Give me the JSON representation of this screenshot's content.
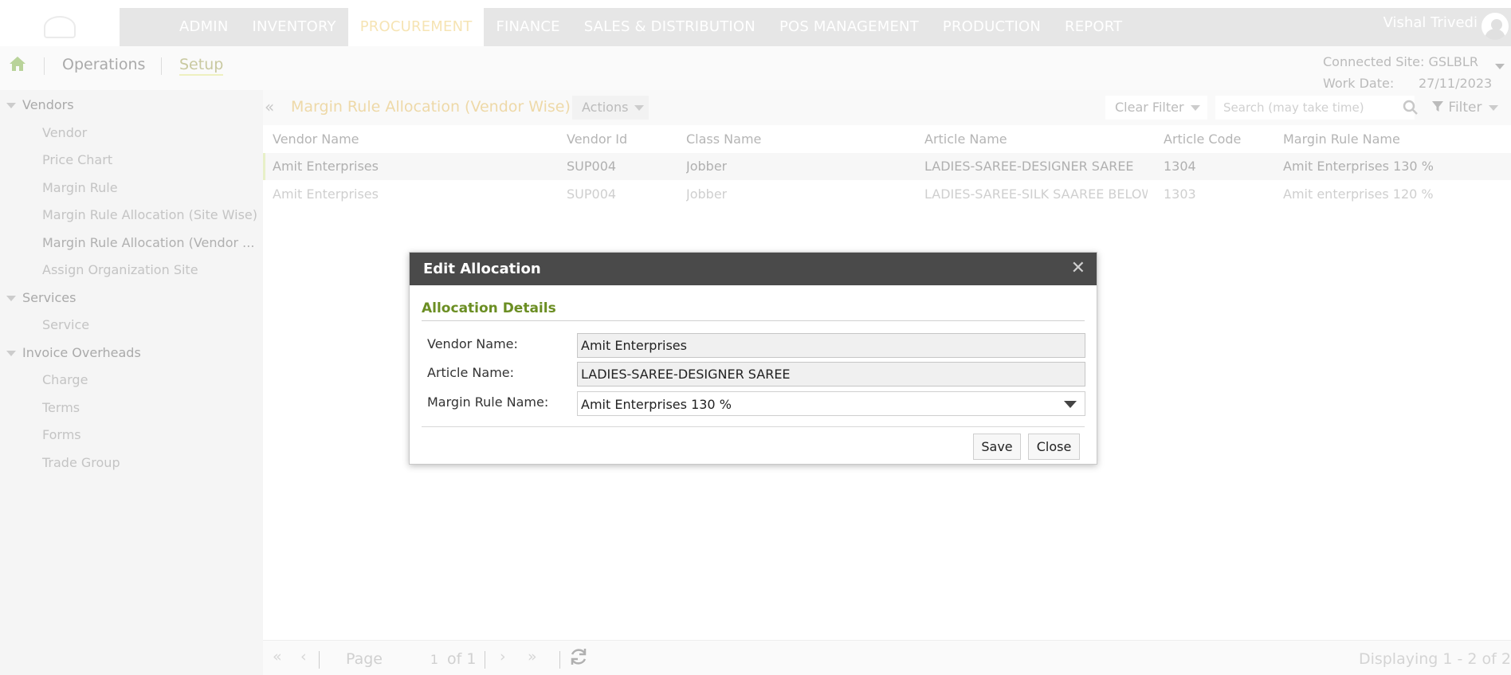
{
  "topnav": {
    "menu": [
      "ADMIN",
      "INVENTORY",
      "PROCUREMENT",
      "FINANCE",
      "SALES & DISTRIBUTION",
      "POS MANAGEMENT",
      "PRODUCTION",
      "REPORT"
    ],
    "active": "PROCUREMENT",
    "user_name": "Vishal Trivedi"
  },
  "subnav": {
    "tabs": [
      "Operations",
      "Setup"
    ],
    "connected_site_label": "Connected Site:",
    "connected_site_value": "GSLBLR",
    "work_date_label": "Work Date:",
    "work_date_value": "27/11/2023"
  },
  "sidebar": {
    "groups": [
      {
        "label": "Vendors",
        "items": [
          "Vendor",
          "Price Chart",
          "Margin Rule",
          "Margin Rule Allocation (Site Wise)",
          "Margin Rule Allocation (Vendor ...",
          "Assign Organization Site"
        ]
      },
      {
        "label": "Services",
        "items": [
          "Service"
        ]
      },
      {
        "label": "Invoice Overheads",
        "items": [
          "Charge",
          "Terms",
          "Forms",
          "Trade Group"
        ]
      }
    ]
  },
  "main": {
    "title": "Margin Rule Allocation (Vendor Wise)",
    "actions_label": "Actions",
    "clear_filter_label": "Clear Filter",
    "search_placeholder": "Search (may take time)",
    "filter_label": "Filter",
    "columns": [
      "Vendor Name",
      "Vendor Id",
      "Class Name",
      "Article Name",
      "Article Code",
      "Margin Rule Name"
    ],
    "rows": [
      [
        "Amit Enterprises",
        "SUP004",
        "Jobber",
        "LADIES-SAREE-DESIGNER SAREE",
        "1304",
        "Amit Enterprises 130 %"
      ],
      [
        "Amit Enterprises",
        "SUP004",
        "Jobber",
        "LADIES-SAREE-SILK SAAREE BELOW ...",
        "1303",
        "Amit enterprises 120 %"
      ]
    ]
  },
  "pager": {
    "page_label": "Page",
    "page_value": "1",
    "of_label": "of 1",
    "displaying": "Displaying 1 - 2 of 2"
  },
  "dialog": {
    "title": "Edit Allocation",
    "section": "Allocation Details",
    "vendor_label": "Vendor Name:",
    "vendor_value": "Amit Enterprises",
    "article_label": "Article Name:",
    "article_value": "LADIES-SAREE-DESIGNER SAREE",
    "margin_label": "Margin Rule Name:",
    "margin_value": "Amit Enterprises 130 %",
    "save_label": "Save",
    "close_label": "Close"
  },
  "colors": {
    "header_bg": "#e6e6e6",
    "active_menu_text": "#f6e4b4",
    "dialog_header": "#4a4a4a",
    "section_green": "#6b8e23"
  },
  "icons": [
    "home-icon",
    "double-chevron-left-icon",
    "chevron-down-icon",
    "search-icon",
    "filter-icon",
    "close-icon",
    "first-page-icon",
    "prev-page-icon",
    "next-page-icon",
    "last-page-icon",
    "refresh-icon",
    "user-avatar-icon"
  ]
}
